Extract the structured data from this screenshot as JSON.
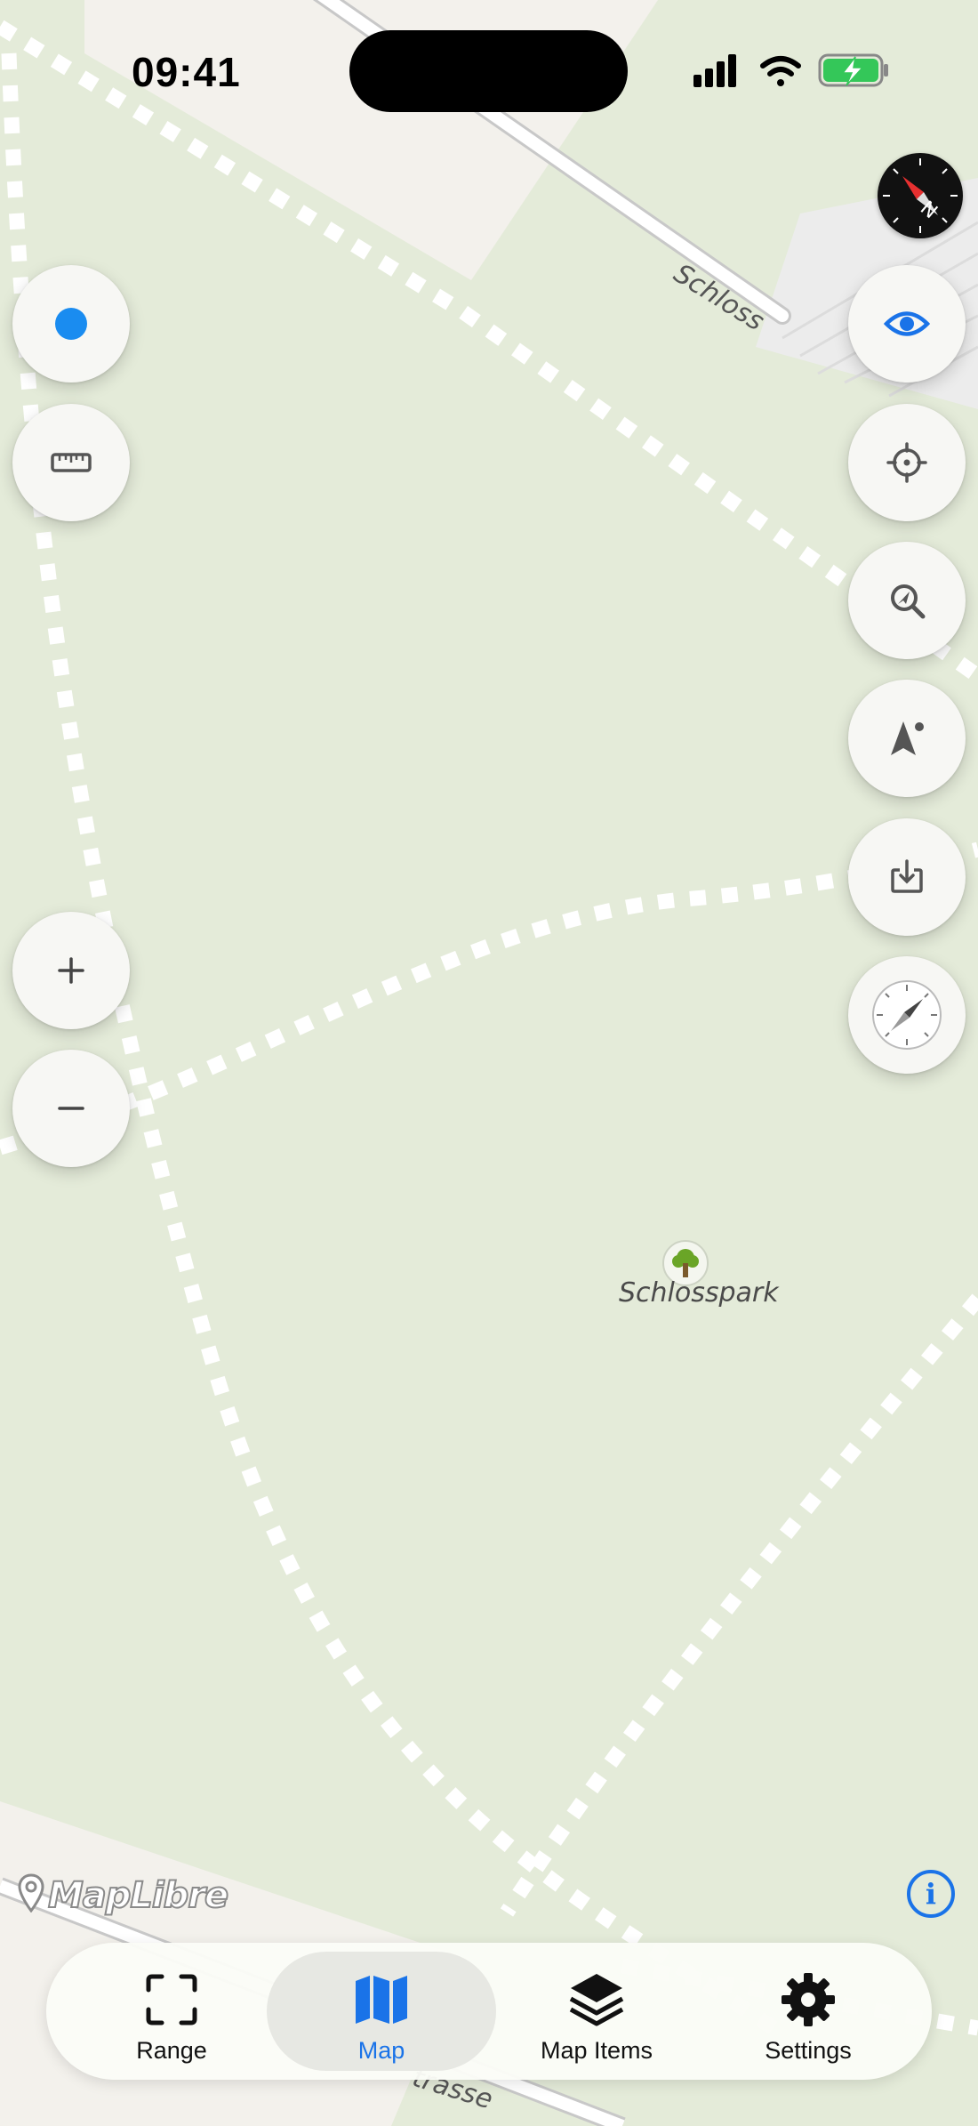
{
  "status_bar": {
    "time": "09:41",
    "icons": [
      "signal-icon",
      "wifi-icon",
      "battery-charging-icon"
    ]
  },
  "map": {
    "labels": {
      "road_schloss": "Schloss",
      "park": "Schlosspark",
      "road_strasse": "trasse"
    },
    "attribution": "MapLibre",
    "colors": {
      "land": "#e4ebd9",
      "path": "#ffffff",
      "accent": "#1a73e8",
      "park_icon": "#6aa527"
    }
  },
  "left_controls": [
    {
      "name": "location-dot-button",
      "icon": "blue-dot-icon"
    },
    {
      "name": "ruler-button",
      "icon": "ruler-icon"
    },
    {
      "name": "zoom-in-button",
      "icon": "plus-icon"
    },
    {
      "name": "zoom-out-button",
      "icon": "minus-icon"
    }
  ],
  "right_controls": [
    {
      "name": "visibility-button",
      "icon": "eye-icon"
    },
    {
      "name": "locate-button",
      "icon": "crosshair-icon"
    },
    {
      "name": "zoom-to-fit-button",
      "icon": "magnify-arrow-icon"
    },
    {
      "name": "navigation-button",
      "icon": "navigation-arrow-icon"
    },
    {
      "name": "download-button",
      "icon": "download-tray-icon"
    },
    {
      "name": "compass-button",
      "icon": "compass-icon"
    }
  ],
  "tabs": [
    {
      "label": "Range",
      "icon": "range-frame-icon",
      "selected": false
    },
    {
      "label": "Map",
      "icon": "map-icon",
      "selected": true
    },
    {
      "label": "Map Items",
      "icon": "layers-icon",
      "selected": false
    },
    {
      "label": "Settings",
      "icon": "gear-icon",
      "selected": false
    }
  ]
}
